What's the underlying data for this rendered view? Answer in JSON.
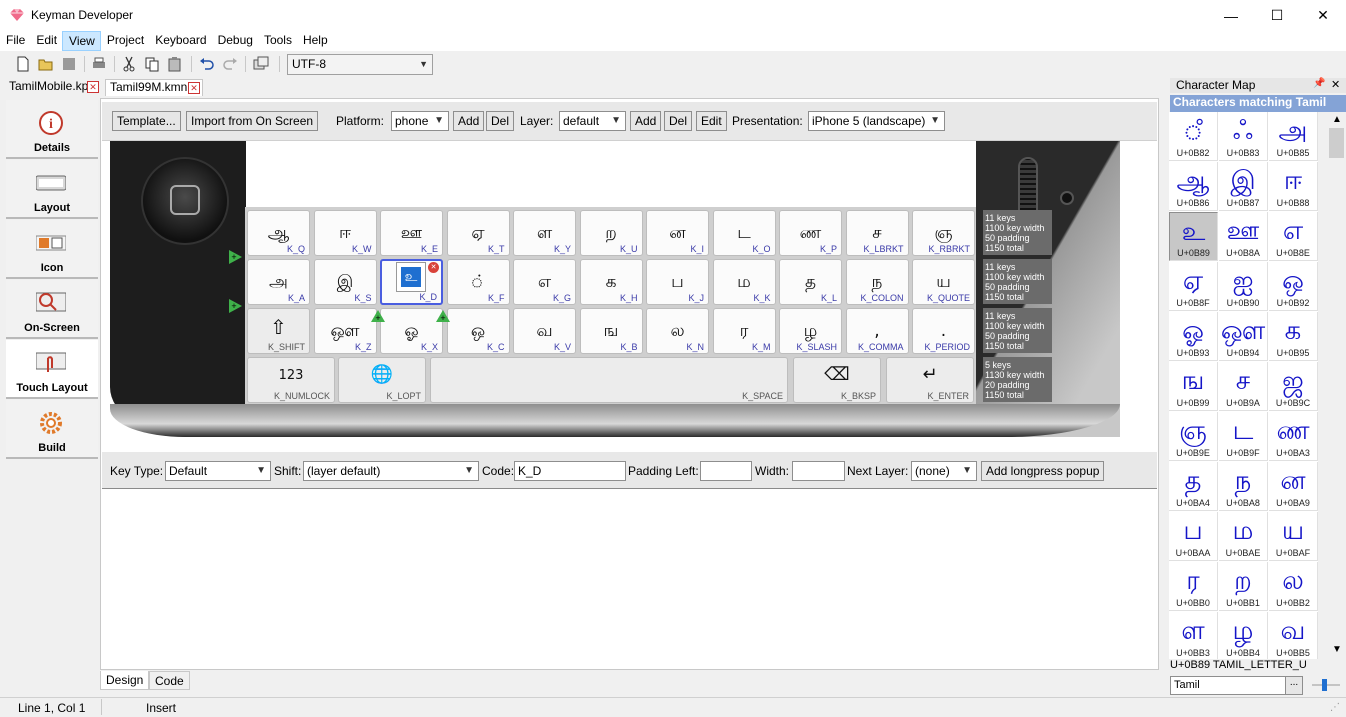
{
  "window": {
    "title": "Keyman Developer",
    "minimize": "—",
    "maximize": "☐",
    "close": "✕"
  },
  "menu": [
    "File",
    "Edit",
    "View",
    "Project",
    "Keyboard",
    "Debug",
    "Tools",
    "Help"
  ],
  "toolbar": {
    "icons": [
      "new-file-icon",
      "open-folder-icon",
      "save-icon",
      "print-icon",
      "cut-icon",
      "copy-icon",
      "paste-icon",
      "undo-icon",
      "redo-icon",
      "window-icon"
    ],
    "encoding": "UTF-8"
  },
  "tabs": [
    {
      "label": "TamilMobile.kpj",
      "close": "✕"
    },
    {
      "label": "Tamil99M.kmn",
      "close": "✕"
    }
  ],
  "nav": [
    {
      "label": "Details",
      "icon": "info-icon"
    },
    {
      "label": "Layout",
      "icon": "keyboard-icon"
    },
    {
      "label": "Icon",
      "icon": "icon-editor-icon"
    },
    {
      "label": "On-Screen",
      "icon": "on-screen-keyboard-icon"
    },
    {
      "label": "Touch Layout",
      "icon": "touch-layout-icon"
    },
    {
      "label": "Build",
      "icon": "gear-icon"
    }
  ],
  "touch_toolbar": {
    "template": "Template...",
    "import": "Import from On Screen",
    "platform_label": "Platform:",
    "platform": "phone",
    "add": "Add",
    "del": "Del",
    "layer_label": "Layer:",
    "layer": "default",
    "edit": "Edit",
    "presentation_label": "Presentation:",
    "presentation": "iPhone 5 (landscape)"
  },
  "keyboard": {
    "rows": [
      [
        {
          "cap": "ஆ",
          "id": "K_Q"
        },
        {
          "cap": "ஈ",
          "id": "K_W"
        },
        {
          "cap": "ஊ",
          "id": "K_E"
        },
        {
          "cap": "ஏ",
          "id": "K_T"
        },
        {
          "cap": "ள",
          "id": "K_Y"
        },
        {
          "cap": "ற",
          "id": "K_U"
        },
        {
          "cap": "ன",
          "id": "K_I"
        },
        {
          "cap": "ட",
          "id": "K_O"
        },
        {
          "cap": "ண",
          "id": "K_P"
        },
        {
          "cap": "ச",
          "id": "K_LBRKT"
        },
        {
          "cap": "ஞ",
          "id": "K_RBRKT"
        }
      ],
      [
        {
          "cap": "அ",
          "id": "K_A"
        },
        {
          "cap": "இ",
          "id": "K_S"
        },
        {
          "cap": "உ",
          "id": "K_D"
        },
        {
          "cap": "்",
          "id": "K_F"
        },
        {
          "cap": "எ",
          "id": "K_G"
        },
        {
          "cap": "க",
          "id": "K_H"
        },
        {
          "cap": "ப",
          "id": "K_J"
        },
        {
          "cap": "ம",
          "id": "K_K"
        },
        {
          "cap": "த",
          "id": "K_L"
        },
        {
          "cap": "ந",
          "id": "K_COLON"
        },
        {
          "cap": "ய",
          "id": "K_QUOTE"
        }
      ],
      [
        {
          "cap": "⇧",
          "id": "K_SHIFT"
        },
        {
          "cap": "ஔ",
          "id": "K_Z"
        },
        {
          "cap": "ஓ",
          "id": "K_X"
        },
        {
          "cap": "ஒ",
          "id": "K_C"
        },
        {
          "cap": "வ",
          "id": "K_V"
        },
        {
          "cap": "ங",
          "id": "K_B"
        },
        {
          "cap": "ல",
          "id": "K_N"
        },
        {
          "cap": "ர",
          "id": "K_M"
        },
        {
          "cap": "ழ",
          "id": "K_SLASH"
        },
        {
          "cap": ",",
          "id": "K_COMMA"
        },
        {
          "cap": ".",
          "id": "K_PERIOD"
        }
      ],
      [
        {
          "cap": "123",
          "id": "K_NUMLOCK"
        },
        {
          "cap": "🌐",
          "id": "K_LOPT"
        },
        {
          "cap": "",
          "id": "K_SPACE"
        },
        {
          "cap": "⌫",
          "id": "K_BKSP"
        },
        {
          "cap": "↵",
          "id": "K_ENTER"
        }
      ]
    ],
    "row_info": [
      [
        "11 keys",
        "1100 key width",
        "50 padding",
        "1150 total"
      ],
      [
        "11 keys",
        "1100 key width",
        "50 padding",
        "1150 total"
      ],
      [
        "11 keys",
        "1100 key width",
        "50 padding",
        "1150 total"
      ],
      [
        "5 keys",
        "1130 key width",
        "20 padding",
        "1150 total"
      ]
    ],
    "popup": {
      "cap": "உ",
      "remove": "✕"
    }
  },
  "properties": {
    "key_type_label": "Key Type:",
    "key_type": "Default",
    "shift_label": "Shift:",
    "shift": "(layer default)",
    "code_label": "Code:",
    "code": "K_D",
    "padding_left_label": "Padding Left:",
    "padding_left": "",
    "width_label": "Width:",
    "width": "",
    "next_layer_label": "Next Layer:",
    "next_layer": "(none)",
    "add_longpress": "Add longpress popup"
  },
  "bottom_tabs": [
    "Design",
    "Code"
  ],
  "status": {
    "position": "Line 1, Col 1",
    "mode": "Insert"
  },
  "charmap": {
    "title": "Character Map",
    "header": "Characters matching Tamil",
    "cells": [
      {
        "g": "ஂ",
        "c": "U+0B82"
      },
      {
        "g": "ஃ",
        "c": "U+0B83"
      },
      {
        "g": "அ",
        "c": "U+0B85"
      },
      {
        "g": "ஆ",
        "c": "U+0B86"
      },
      {
        "g": "இ",
        "c": "U+0B87"
      },
      {
        "g": "ஈ",
        "c": "U+0B88"
      },
      {
        "g": "உ",
        "c": "U+0B89"
      },
      {
        "g": "ஊ",
        "c": "U+0B8A"
      },
      {
        "g": "எ",
        "c": "U+0B8E"
      },
      {
        "g": "ஏ",
        "c": "U+0B8F"
      },
      {
        "g": "ஐ",
        "c": "U+0B90"
      },
      {
        "g": "ஒ",
        "c": "U+0B92"
      },
      {
        "g": "ஓ",
        "c": "U+0B93"
      },
      {
        "g": "ஔ",
        "c": "U+0B94"
      },
      {
        "g": "க",
        "c": "U+0B95"
      },
      {
        "g": "ங",
        "c": "U+0B99"
      },
      {
        "g": "ச",
        "c": "U+0B9A"
      },
      {
        "g": "ஜ",
        "c": "U+0B9C"
      },
      {
        "g": "ஞ",
        "c": "U+0B9E"
      },
      {
        "g": "ட",
        "c": "U+0B9F"
      },
      {
        "g": "ண",
        "c": "U+0BA3"
      },
      {
        "g": "த",
        "c": "U+0BA4"
      },
      {
        "g": "ந",
        "c": "U+0BA8"
      },
      {
        "g": "ன",
        "c": "U+0BA9"
      },
      {
        "g": "ப",
        "c": "U+0BAA"
      },
      {
        "g": "ம",
        "c": "U+0BAE"
      },
      {
        "g": "ய",
        "c": "U+0BAF"
      },
      {
        "g": "ர",
        "c": "U+0BB0"
      },
      {
        "g": "ற",
        "c": "U+0BB1"
      },
      {
        "g": "ல",
        "c": "U+0BB2"
      },
      {
        "g": "ள",
        "c": "U+0BB3"
      },
      {
        "g": "ழ",
        "c": "U+0BB4"
      },
      {
        "g": "வ",
        "c": "U+0BB5"
      }
    ],
    "selected_name": "U+0B89 TAMIL_LETTER_U",
    "filter": "Tamil",
    "filter_btn": "...",
    "pin": "📌",
    "close": "✕"
  }
}
